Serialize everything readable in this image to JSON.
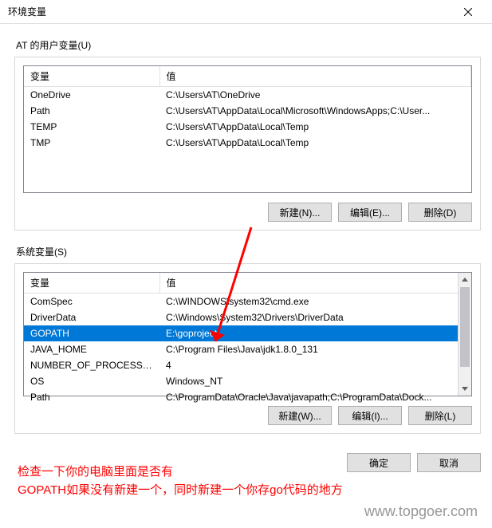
{
  "dialog": {
    "title": "环境变量",
    "close_tooltip": "关闭"
  },
  "user_section": {
    "label": "AT 的用户变量(U)",
    "headers": {
      "variable": "变量",
      "value": "值"
    },
    "rows": [
      {
        "variable": "OneDrive",
        "value": "C:\\Users\\AT\\OneDrive"
      },
      {
        "variable": "Path",
        "value": "C:\\Users\\AT\\AppData\\Local\\Microsoft\\WindowsApps;C:\\User..."
      },
      {
        "variable": "TEMP",
        "value": "C:\\Users\\AT\\AppData\\Local\\Temp"
      },
      {
        "variable": "TMP",
        "value": "C:\\Users\\AT\\AppData\\Local\\Temp"
      }
    ],
    "buttons": {
      "new": "新建(N)...",
      "edit": "编辑(E)...",
      "delete": "删除(D)"
    }
  },
  "system_section": {
    "label": "系统变量(S)",
    "headers": {
      "variable": "变量",
      "value": "值"
    },
    "rows": [
      {
        "variable": "ComSpec",
        "value": "C:\\WINDOWS\\system32\\cmd.exe",
        "selected": false
      },
      {
        "variable": "DriverData",
        "value": "C:\\Windows\\System32\\Drivers\\DriverData",
        "selected": false
      },
      {
        "variable": "GOPATH",
        "value": "E:\\goproject",
        "selected": true
      },
      {
        "variable": "JAVA_HOME",
        "value": "C:\\Program Files\\Java\\jdk1.8.0_131",
        "selected": false
      },
      {
        "variable": "NUMBER_OF_PROCESSORS",
        "value": "4",
        "selected": false
      },
      {
        "variable": "OS",
        "value": "Windows_NT",
        "selected": false
      },
      {
        "variable": "Path",
        "value": "C:\\ProgramData\\Oracle\\Java\\javapath;C:\\ProgramData\\Dock...",
        "selected": false
      }
    ],
    "buttons": {
      "new": "新建(W)...",
      "edit": "编辑(I)...",
      "delete": "删除(L)"
    }
  },
  "dialog_buttons": {
    "ok": "确定",
    "cancel": "取消"
  },
  "annotation": {
    "line1": "检查一下你的电脑里面是否有",
    "line2": "GOPATH如果没有新建一个，同时新建一个你存go代码的地方"
  },
  "watermark": "www.topgoer.com"
}
